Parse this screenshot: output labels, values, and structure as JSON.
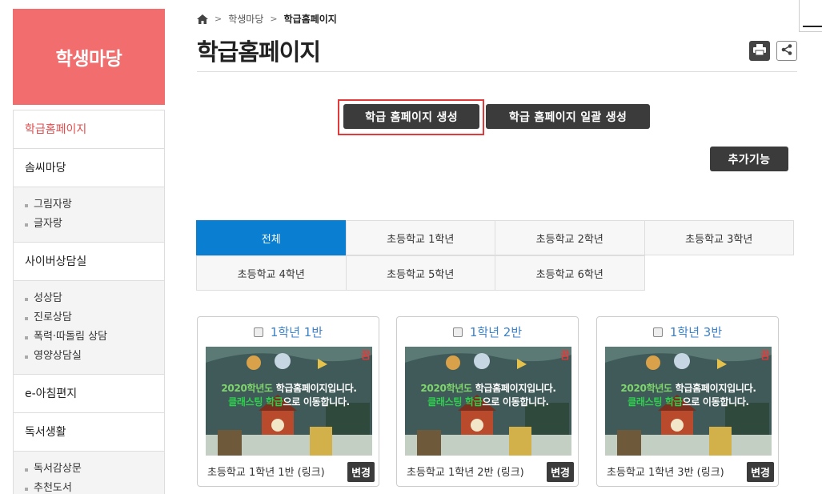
{
  "sidebar": {
    "title": "학생마당",
    "menu": [
      {
        "label": "학급홈페이지",
        "active": true
      },
      {
        "label": "솜씨마당"
      }
    ],
    "sub1": [
      "그림자랑",
      "글자랑"
    ],
    "menu2": "사이버상담실",
    "sub2": [
      "성상담",
      "진로상담",
      "폭력·따돌림 상담",
      "영양상담실"
    ],
    "menu3": "e-아침편지",
    "menu4": "독서생활",
    "sub4": [
      "독서감상문",
      "추천도서"
    ]
  },
  "breadcrumb": {
    "home_icon": "home-icon",
    "level1": "학생마당",
    "current": "학급홈페이지"
  },
  "page": {
    "title": "학급홈페이지",
    "print_icon": "print-icon",
    "share_icon": "share-icon"
  },
  "actions": {
    "create": "학급 홈페이지 생성",
    "batch_create": "학급 홈페이지 일괄 생성",
    "extra": "추가기능"
  },
  "tabs": {
    "row1": [
      "전체",
      "초등학교 1학년",
      "초등학교 2학년",
      "초등학교 3학년"
    ],
    "row2": [
      "초등학교 4학년",
      "초등학교 5학년",
      "초등학교 6학년"
    ],
    "active_index": 0
  },
  "cards": [
    {
      "title": "1학년 1반",
      "thumb_line1_a": "2020학년도",
      "thumb_line1_b": " 학급홈페이지입니다.",
      "thumb_line2_a": "클래스팅 학급",
      "thumb_line2_b": "으로 이동합니다.",
      "footer": "초등학교 1학년  1반 (링크)",
      "button": "변경"
    },
    {
      "title": "1학년 2반",
      "thumb_line1_a": "2020학년도",
      "thumb_line1_b": " 학급홈페이지입니다.",
      "thumb_line2_a": "클래스팅 학급",
      "thumb_line2_b": "으로 이동합니다.",
      "footer": "초등학교 1학년  2반 (링크)",
      "button": "변경"
    },
    {
      "title": "1학년 3반",
      "thumb_line1_a": "2020학년도",
      "thumb_line1_b": " 학급홈페이지입니다.",
      "thumb_line2_a": "클래스팅 학급",
      "thumb_line2_b": "으로 이동합니다.",
      "footer": "초등학교 1학년  3반 (링크)",
      "button": "변경"
    }
  ],
  "thumb_corner_text": "꿈",
  "colors": {
    "sidebar_header": "#f26d6d",
    "active_tab": "#0a7fd1",
    "dark_button": "#3b3b3b",
    "highlight": "#e23a3a",
    "card_title": "#3d82c9"
  }
}
